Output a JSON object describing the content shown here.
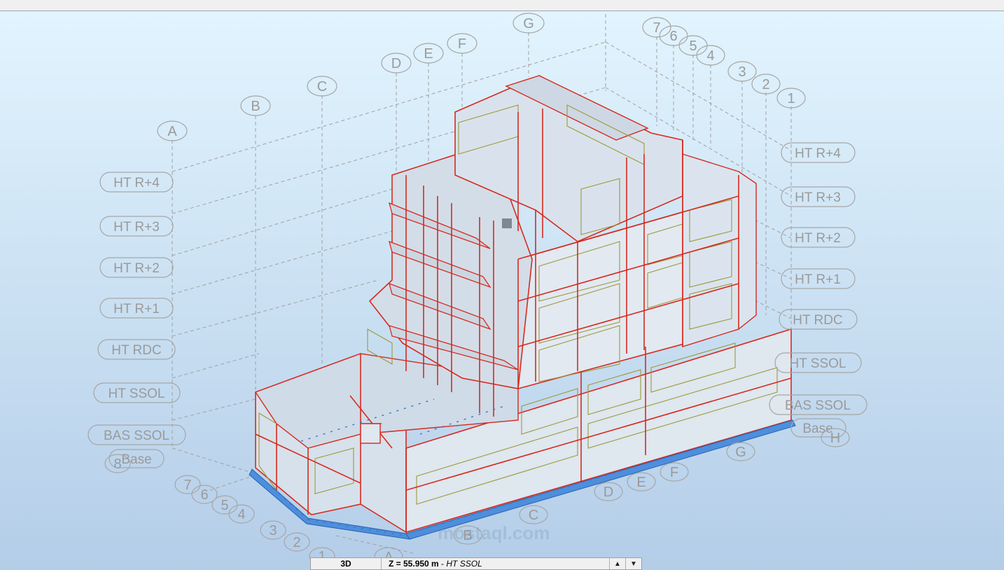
{
  "grid_letters": [
    "A",
    "B",
    "C",
    "D",
    "E",
    "F",
    "G"
  ],
  "grid_letters_bottom": [
    "A",
    "B",
    "C",
    "D",
    "E",
    "F",
    "G",
    "H"
  ],
  "grid_numbers": [
    "7",
    "6",
    "5",
    "4",
    "3",
    "2",
    "1"
  ],
  "grid_numbers_left": [
    "8",
    "7",
    "6",
    "5",
    "4",
    "3",
    "2",
    "1"
  ],
  "levels_left": [
    "HT R+4",
    "HT R+3",
    "HT R+2",
    "HT R+1",
    "HT RDC",
    "HT SSOL",
    "BAS SSOL",
    "Base"
  ],
  "levels_right": [
    "HT R+4",
    "HT R+3",
    "HT R+2",
    "HT R+1",
    "HT RDC",
    "HT SSOL",
    "BAS SSOL",
    "Base"
  ],
  "statusbar": {
    "view_label": "3D",
    "z_value": "Z = 55.950 m",
    "z_sep": " - ",
    "z_level": "HT SSOL",
    "up_arrow": "▲",
    "down_arrow": "▼"
  },
  "watermark": "mostaql.com",
  "colors": {
    "beam": "#d62a1e",
    "panel": "#dde6f0",
    "support": "#3f7fd0",
    "grid": "#9a9a9a"
  }
}
